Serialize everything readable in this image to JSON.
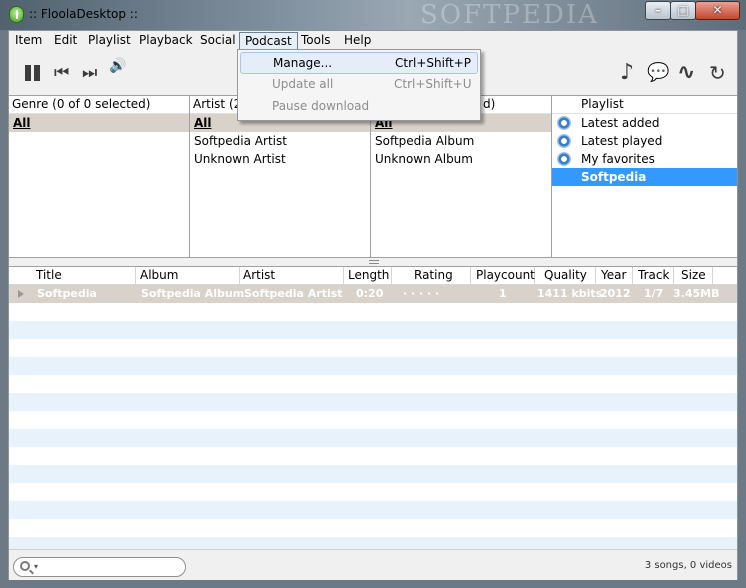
{
  "window": {
    "title": ":: FloolaDesktop ::",
    "watermark": "SOFTPEDIA",
    "controls": {
      "minimize": "–",
      "maximize": "□",
      "close": "✕"
    }
  },
  "menubar": {
    "items": [
      "Item",
      "Edit",
      "Playlist",
      "Playback",
      "Social",
      "Podcast",
      "Tools",
      "Help"
    ],
    "active": "Podcast"
  },
  "podcast_menu": {
    "items": [
      {
        "label": "Manage...",
        "shortcut": "Ctrl+Shift+P",
        "state": "hover"
      },
      {
        "label": "Update all",
        "shortcut": "Ctrl+Shift+U",
        "state": "disabled"
      },
      {
        "label": "Pause download",
        "shortcut": "",
        "state": "disabled"
      }
    ]
  },
  "toolbar": {
    "left_icons": [
      "pause-icon",
      "previous-icon",
      "next-icon",
      "volume-icon"
    ],
    "right_icons": [
      "music-note-icon",
      "speech-bubble-icon",
      "waveform-icon",
      "refresh-icon"
    ],
    "glyphs": {
      "previous": "⏮",
      "next": "⏭",
      "volume": "🔊",
      "music": "♪",
      "speech": "💬",
      "wave": "∿",
      "refresh": "↻"
    }
  },
  "browser": {
    "genre": {
      "header": "Genre (0 of 0 selected)",
      "rows": [
        "All"
      ]
    },
    "artist": {
      "header": "Artist (2",
      "rows": [
        "All",
        "Softpedia Artist",
        "Unknown Artist"
      ]
    },
    "album": {
      "header": "d)",
      "rows": [
        "All",
        "Softpedia Album",
        "Unknown Album"
      ]
    },
    "playlist": {
      "header": "Playlist",
      "rows": [
        {
          "label": "Latest added",
          "icon": "gear-icon",
          "selected": false
        },
        {
          "label": "Latest played",
          "icon": "gear-icon",
          "selected": false
        },
        {
          "label": "My favorites",
          "icon": "gear-icon",
          "selected": false
        },
        {
          "label": "Softpedia",
          "icon": "",
          "selected": true
        }
      ]
    }
  },
  "tracklist": {
    "columns": [
      "Title",
      "Album",
      "Artist",
      "Length",
      "Rating",
      "Playcount",
      "Quality",
      "Year",
      "Track",
      "Size"
    ],
    "rows": [
      {
        "title": "Softpedia",
        "album": "Softpedia Album",
        "artist": "Softpedia Artist",
        "length": "0:20",
        "rating": "· · · · ·",
        "playcount": "1",
        "quality": "1411 kbits",
        "year": "2012",
        "track": "1/7",
        "size": "3.45MB"
      }
    ]
  },
  "statusbar": {
    "search_placeholder": "",
    "search_dropdown": "▾",
    "summary": "3 songs, 0 videos"
  }
}
